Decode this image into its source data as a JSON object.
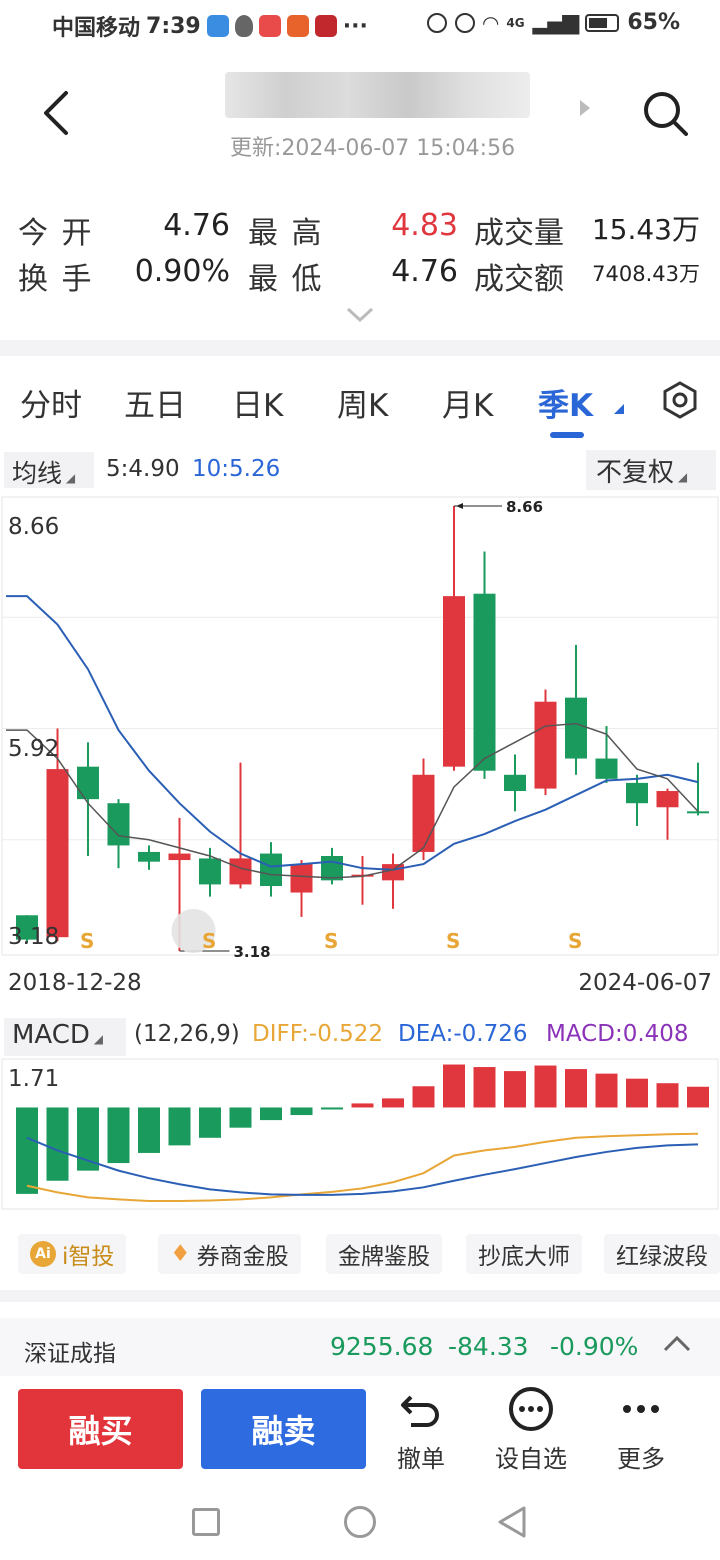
{
  "status_bar": {
    "carrier": "中国移动",
    "time": "7:39",
    "network": "4G",
    "battery": "65%"
  },
  "header": {
    "update_label": "更新:",
    "update_time": "2024-06-07 15:04:56"
  },
  "quote": {
    "open_label": "今 开",
    "open_value": "4.76",
    "high_label": "最 高",
    "high_value": "4.83",
    "volume_label": "成交量",
    "volume_value": "15.43万",
    "turnover_label": "换 手",
    "turnover_value": "0.90%",
    "low_label": "最 低",
    "low_value": "4.76",
    "amount_label": "成交额",
    "amount_value": "7408.43万"
  },
  "tabs": [
    {
      "label": "分时"
    },
    {
      "label": "五日"
    },
    {
      "label": "日K"
    },
    {
      "label": "周K"
    },
    {
      "label": "月K"
    },
    {
      "label": "季K",
      "active": true
    }
  ],
  "ma": {
    "button_label": "均线",
    "ma5": "5:4.90",
    "ma10": "10:5.26",
    "adjust_label": "不复权"
  },
  "chart_data": [
    {
      "type": "candlestick",
      "x_start": "2018-12-28",
      "x_end": "2024-06-07",
      "y_labels": [
        "8.66",
        "5.92",
        "3.18"
      ],
      "ylim": [
        3.18,
        8.66
      ],
      "max_label": "8.66",
      "min_label": "3.18",
      "marker_label": "S",
      "colors": {
        "up": "#e0373e",
        "down": "#1a9a5c",
        "ma5": "#555555",
        "ma10": "#2a5fb5"
      },
      "candles": [
        {
          "o": 3.32,
          "h": 3.55,
          "l": 3.28,
          "c": 3.62,
          "d": -1
        },
        {
          "o": 3.35,
          "h": 5.92,
          "l": 3.3,
          "c": 5.42,
          "d": 1
        },
        {
          "o": 5.45,
          "h": 5.75,
          "l": 4.35,
          "c": 5.05,
          "d": -1
        },
        {
          "o": 5.0,
          "h": 5.05,
          "l": 4.2,
          "c": 4.48,
          "d": -1
        },
        {
          "o": 4.4,
          "h": 4.48,
          "l": 4.18,
          "c": 4.28,
          "d": -1
        },
        {
          "o": 4.3,
          "h": 4.82,
          "l": 3.18,
          "c": 4.38,
          "d": 1
        },
        {
          "o": 4.32,
          "h": 4.45,
          "l": 3.85,
          "c": 4.0,
          "d": -1
        },
        {
          "o": 4.0,
          "h": 5.5,
          "l": 3.95,
          "c": 4.32,
          "d": 1
        },
        {
          "o": 4.38,
          "h": 4.52,
          "l": 3.85,
          "c": 3.98,
          "d": -1
        },
        {
          "o": 3.9,
          "h": 4.3,
          "l": 3.6,
          "c": 4.25,
          "d": 1
        },
        {
          "o": 4.35,
          "h": 4.45,
          "l": 4.0,
          "c": 4.05,
          "d": -1
        },
        {
          "o": 4.1,
          "h": 4.35,
          "l": 3.75,
          "c": 4.12,
          "d": 1
        },
        {
          "o": 4.05,
          "h": 4.38,
          "l": 3.7,
          "c": 4.25,
          "d": 1
        },
        {
          "o": 4.4,
          "h": 5.55,
          "l": 4.3,
          "c": 5.35,
          "d": 1
        },
        {
          "o": 5.45,
          "h": 8.66,
          "l": 5.4,
          "c": 7.55,
          "d": 1
        },
        {
          "o": 7.58,
          "h": 8.1,
          "l": 5.3,
          "c": 5.4,
          "d": -1
        },
        {
          "o": 5.35,
          "h": 5.6,
          "l": 4.9,
          "c": 5.15,
          "d": -1
        },
        {
          "o": 5.18,
          "h": 6.4,
          "l": 5.1,
          "c": 6.25,
          "d": 1
        },
        {
          "o": 6.3,
          "h": 6.95,
          "l": 5.35,
          "c": 5.55,
          "d": -1
        },
        {
          "o": 5.55,
          "h": 5.95,
          "l": 5.25,
          "c": 5.3,
          "d": -1
        },
        {
          "o": 5.25,
          "h": 5.35,
          "l": 4.72,
          "c": 5.0,
          "d": -1
        },
        {
          "o": 5.15,
          "h": 5.18,
          "l": 4.55,
          "c": 4.95,
          "d": 1
        },
        {
          "o": 4.9,
          "h": 5.5,
          "l": 4.85,
          "c": 4.9,
          "d": -1
        }
      ],
      "ma5": [
        5.9,
        5.55,
        5.0,
        4.6,
        4.55,
        4.45,
        4.35,
        4.2,
        4.12,
        4.1,
        4.08,
        4.1,
        4.18,
        4.45,
        5.2,
        5.55,
        5.75,
        5.95,
        5.98,
        5.85,
        5.42,
        5.3,
        4.9
      ],
      "ma10": [
        7.55,
        7.2,
        6.65,
        5.9,
        5.4,
        5.0,
        4.65,
        4.38,
        4.22,
        4.25,
        4.28,
        4.2,
        4.18,
        4.25,
        4.5,
        4.62,
        4.78,
        4.92,
        5.1,
        5.28,
        5.3,
        5.35,
        5.26
      ]
    },
    {
      "type": "bar",
      "title": "MACD",
      "y_label": "1.71",
      "colors": {
        "positive": "#e0373e",
        "negative": "#1a9a5c",
        "diff": "#e8a636",
        "dea": "#2a5fb5"
      },
      "macd": [
        -1.71,
        -1.45,
        -1.25,
        -1.1,
        -0.9,
        -0.75,
        -0.6,
        -0.4,
        -0.25,
        -0.15,
        -0.02,
        0.08,
        0.18,
        0.42,
        0.85,
        0.8,
        0.72,
        0.83,
        0.76,
        0.67,
        0.57,
        0.48,
        0.41
      ],
      "diff": [
        -1.55,
        -1.68,
        -1.78,
        -1.82,
        -1.85,
        -1.85,
        -1.84,
        -1.82,
        -1.78,
        -1.72,
        -1.67,
        -1.6,
        -1.48,
        -1.3,
        -0.95,
        -0.85,
        -0.78,
        -0.68,
        -0.6,
        -0.57,
        -0.55,
        -0.53,
        -0.52
      ],
      "dea": [
        -0.6,
        -0.85,
        -1.05,
        -1.25,
        -1.4,
        -1.52,
        -1.62,
        -1.68,
        -1.72,
        -1.73,
        -1.73,
        -1.71,
        -1.66,
        -1.58,
        -1.45,
        -1.33,
        -1.22,
        -1.1,
        -0.98,
        -0.88,
        -0.8,
        -0.75,
        -0.73
      ]
    }
  ],
  "macd_header": {
    "button_label": "MACD",
    "params": "(12,26,9)",
    "diff": "DIFF:-0.522",
    "dea": "DEA:-0.726",
    "macd": "MACD:0.408"
  },
  "tags": [
    {
      "label": "i智投",
      "badge": "Ai"
    },
    {
      "label": "券商金股"
    },
    {
      "label": "金牌鉴股"
    },
    {
      "label": "抄底大师"
    },
    {
      "label": "红绿波段"
    }
  ],
  "index": {
    "name": "深证成指",
    "value": "9255.68",
    "change": "-84.33",
    "percent": "-0.90%"
  },
  "actions": {
    "buy": "融买",
    "sell": "融卖",
    "cancel": "撤单",
    "watchlist": "设自选",
    "more": "更多"
  }
}
